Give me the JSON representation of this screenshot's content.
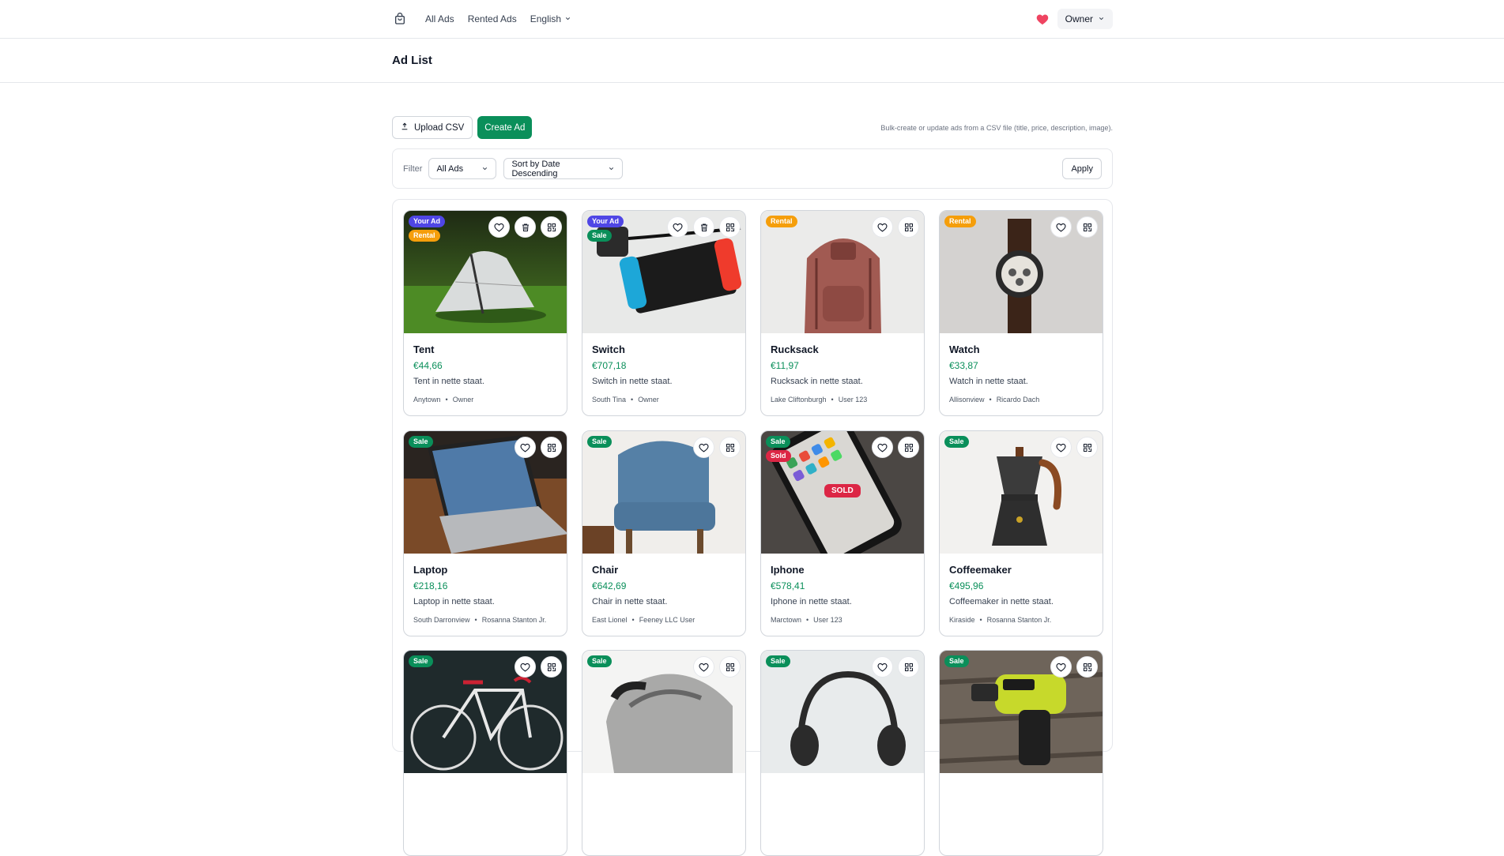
{
  "nav": {
    "links": [
      "All Ads",
      "Rented Ads",
      "English"
    ],
    "user_label": "Owner"
  },
  "page": {
    "title": "Ad List"
  },
  "toolbar": {
    "upload_label": "Upload CSV",
    "create_label": "Create Ad",
    "helper_text": "Bulk-create or update ads from a CSV file (title, price, description, image)."
  },
  "filter": {
    "label": "Filter",
    "type_value": "All Ads",
    "sort_value": "Sort by Date Descending",
    "apply_label": "Apply"
  },
  "colors": {
    "accent": "#0a8f5a",
    "your_ad": "#4f46e5",
    "rental": "#f59e0b",
    "sale": "#0a8f5a",
    "sold": "#dc2645",
    "heart": "#ef4461"
  },
  "ads": [
    {
      "title": "Tent",
      "price": "€44,66",
      "description": "Tent in nette staat.",
      "location": "Anytown",
      "user": "Owner",
      "badges": [
        "Your Ad",
        "Rental"
      ],
      "actions": [
        "heart-icon",
        "trash-icon",
        "qr-icon"
      ],
      "image": "tent"
    },
    {
      "title": "Switch",
      "price": "€707,18",
      "description": "Switch in nette staat.",
      "location": "South Tina",
      "user": "Owner",
      "badges": [
        "Your Ad",
        "Sale"
      ],
      "actions": [
        "heart-icon",
        "trash-icon",
        "qr-icon"
      ],
      "image": "switch"
    },
    {
      "title": "Rucksack",
      "price": "€11,97",
      "description": "Rucksack in nette staat.",
      "location": "Lake Cliftonburgh",
      "user": "User 123",
      "badges": [
        "Rental"
      ],
      "actions": [
        "heart-icon",
        "qr-icon"
      ],
      "image": "rucksack"
    },
    {
      "title": "Watch",
      "price": "€33,87",
      "description": "Watch in nette staat.",
      "location": "Allisonview",
      "user": "Ricardo Dach",
      "badges": [
        "Rental"
      ],
      "actions": [
        "heart-icon",
        "qr-icon"
      ],
      "image": "watch"
    },
    {
      "title": "Laptop",
      "price": "€218,16",
      "description": "Laptop in nette staat.",
      "location": "South Darronview",
      "user": "Rosanna Stanton Jr.",
      "badges": [
        "Sale"
      ],
      "actions": [
        "heart-icon",
        "qr-icon"
      ],
      "image": "laptop"
    },
    {
      "title": "Chair",
      "price": "€642,69",
      "description": "Chair in nette staat.",
      "location": "East Lionel",
      "user": "Feeney LLC User",
      "badges": [
        "Sale"
      ],
      "actions": [
        "heart-icon",
        "qr-icon"
      ],
      "image": "chair"
    },
    {
      "title": "Iphone",
      "price": "€578,41",
      "description": "Iphone in nette staat.",
      "location": "Marctown",
      "user": "User 123",
      "badges": [
        "Sale",
        "Sold"
      ],
      "sold_overlay": "SOLD",
      "actions": [
        "heart-icon",
        "qr-icon"
      ],
      "image": "iphone"
    },
    {
      "title": "Coffeemaker",
      "price": "€495,96",
      "description": "Coffeemaker in nette staat.",
      "location": "Kiraside",
      "user": "Rosanna Stanton Jr.",
      "badges": [
        "Sale"
      ],
      "actions": [
        "heart-icon",
        "qr-icon"
      ],
      "image": "coffeemaker"
    },
    {
      "title": "",
      "price": "",
      "description": "",
      "location": "",
      "user": "",
      "badges": [
        "Sale"
      ],
      "actions": [
        "heart-icon",
        "qr-icon"
      ],
      "image": "bike"
    },
    {
      "title": "",
      "price": "",
      "description": "",
      "location": "",
      "user": "",
      "badges": [
        "Sale"
      ],
      "actions": [
        "heart-icon",
        "qr-icon"
      ],
      "image": "sneaker"
    },
    {
      "title": "",
      "price": "",
      "description": "",
      "location": "",
      "user": "",
      "badges": [
        "Sale"
      ],
      "actions": [
        "heart-icon",
        "qr-icon"
      ],
      "image": "headphones"
    },
    {
      "title": "",
      "price": "",
      "description": "",
      "location": "",
      "user": "",
      "badges": [
        "Sale"
      ],
      "actions": [
        "heart-icon",
        "qr-icon"
      ],
      "image": "drill"
    }
  ]
}
